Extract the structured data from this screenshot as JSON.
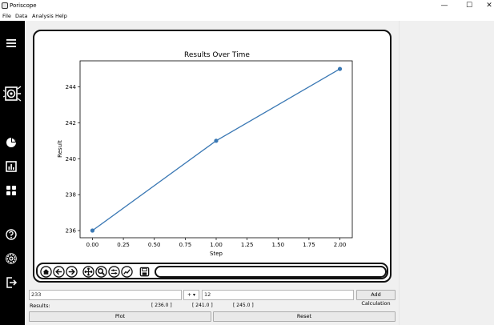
{
  "window": {
    "title": "Poriscope",
    "minimize_glyph": "—",
    "maximize_glyph": "☐",
    "close_glyph": "✕"
  },
  "menu": [
    "File",
    "Data",
    "Analysis",
    "Help"
  ],
  "sidebar": {
    "icons": [
      "menu-icon",
      "speaker-icon",
      "pie-chart-icon",
      "bar-chart-icon",
      "grid-icon",
      "help-icon",
      "settings-icon",
      "logout-icon"
    ]
  },
  "chart_data": {
    "type": "line",
    "title": "Results Over Time",
    "xlabel": "Step",
    "ylabel": "Result",
    "x": [
      0.0,
      1.0,
      2.0
    ],
    "y": [
      236.0,
      241.0,
      245.0
    ],
    "xlim": [
      -0.1,
      2.1
    ],
    "ylim": [
      235.6,
      245.45
    ],
    "xticks": [
      "0.00",
      "0.25",
      "0.50",
      "0.75",
      "1.00",
      "1.25",
      "1.50",
      "1.75",
      "2.00"
    ],
    "yticks": [
      "236",
      "238",
      "240",
      "242",
      "244"
    ],
    "line_color": "#3a78b4"
  },
  "toolbar": {
    "buttons": [
      "home-icon",
      "back-icon",
      "forward-icon",
      "pan-icon",
      "zoom-icon",
      "configure-subplots-icon",
      "edit-axes-icon",
      "save-icon"
    ]
  },
  "controls": {
    "first_value": "233",
    "operator": "+ ▾",
    "second_value": "12",
    "add_label": "Add Calculation",
    "results_label": "Results:",
    "results": [
      "[ 236.0 ]",
      "[ 241.0 ]",
      "[ 245.0 ]"
    ],
    "plot_label": "Plot",
    "reset_label": "Reset"
  }
}
